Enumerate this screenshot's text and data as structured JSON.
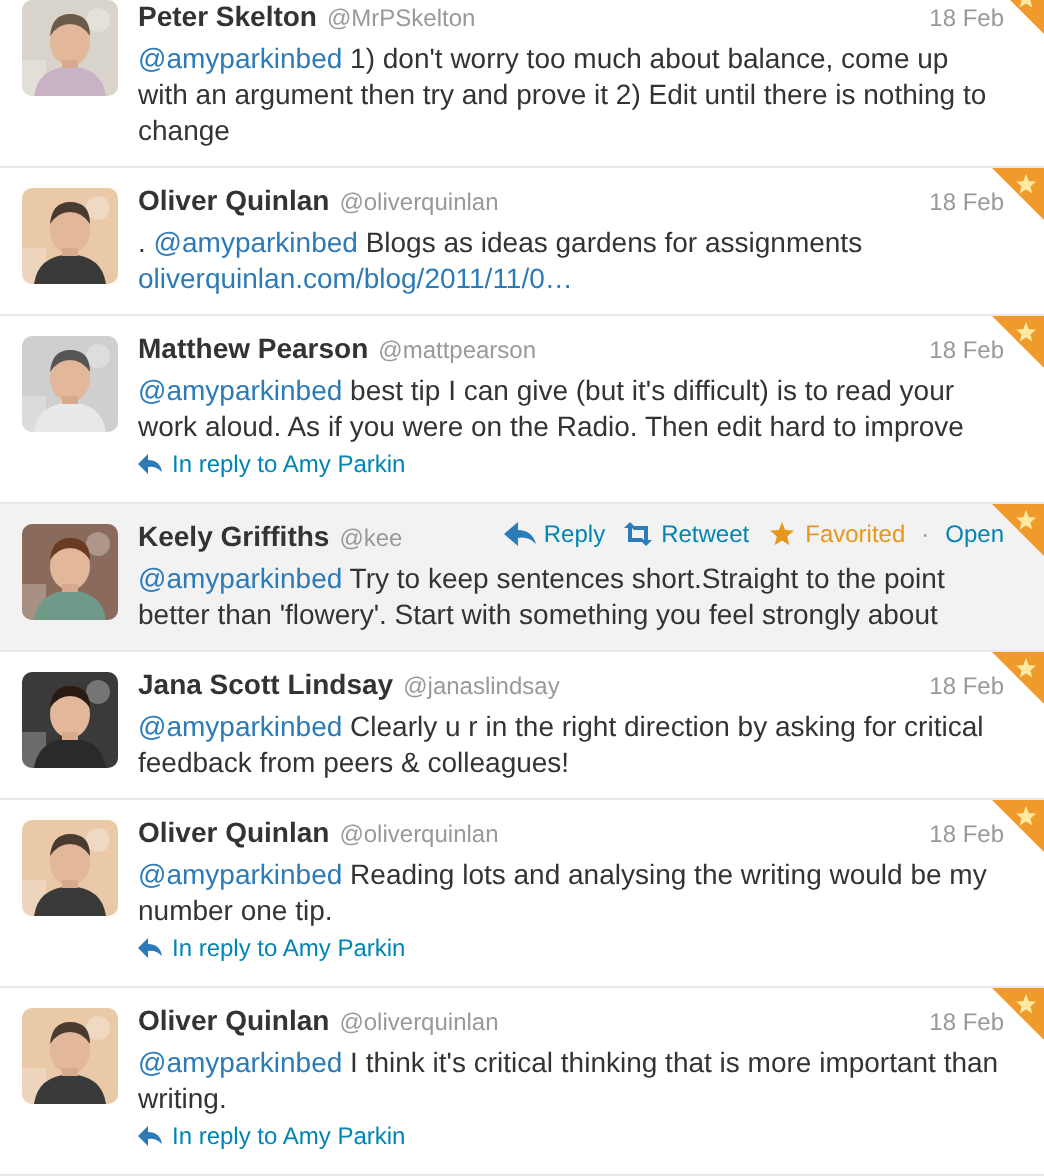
{
  "tweets": [
    {
      "name": "Peter Skelton",
      "handle": "@MrPSkelton",
      "date": "18 Feb",
      "favorited": true,
      "hovered": false,
      "avatar": {
        "kind": "picture"
      },
      "text": [
        {
          "kind": "mention",
          "text": "@amyparkinbed"
        },
        {
          "kind": "text",
          "text": " 1) don't worry too much about balance, come up with an argument then try and prove it 2) Edit until there is nothing to change"
        }
      ]
    },
    {
      "name": "Oliver Quinlan",
      "handle": "@oliverquinlan",
      "date": "18 Feb",
      "favorited": true,
      "hovered": false,
      "avatar": {
        "kind": "picture"
      },
      "lead": ". ",
      "text": [
        {
          "kind": "mention",
          "text": "@amyparkinbed"
        },
        {
          "kind": "text",
          "text": " Blogs as ideas gardens for assignments "
        },
        {
          "kind": "link",
          "text": "oliverquinlan.com/blog/2011/11/0…"
        }
      ]
    },
    {
      "name": "Matthew Pearson",
      "handle": "@mattpearson",
      "date": "18 Feb",
      "favorited": true,
      "hovered": false,
      "avatar": {
        "kind": "picture"
      },
      "text": [
        {
          "kind": "mention",
          "text": "@amyparkinbed"
        },
        {
          "kind": "text",
          "text": " best tip I can give (but it's difficult) is to read your work aloud. As if you were on the Radio. Then edit hard to improve"
        }
      ],
      "reply_to": "In reply to Amy Parkin"
    },
    {
      "name": "Keely Griffiths",
      "handle": "@kee",
      "favorited": true,
      "hovered": true,
      "avatar": {
        "kind": "picture"
      },
      "actions": [
        {
          "kind": "reply",
          "label": "Reply"
        },
        {
          "kind": "retweet",
          "label": "Retweet"
        },
        {
          "kind": "favorite",
          "label": "Favorited"
        },
        {
          "kind": "separator",
          "label": "·"
        },
        {
          "kind": "open",
          "label": "Open"
        }
      ],
      "text": [
        {
          "kind": "mention",
          "text": "@amyparkinbed"
        },
        {
          "kind": "text",
          "text": " Try to keep sentences short.Straight to the point better than 'flowery'. Start with something you feel strongly about"
        }
      ]
    },
    {
      "name": "Jana Scott Lindsay",
      "handle": "@janaslindsay",
      "date": "18 Feb",
      "favorited": true,
      "hovered": false,
      "avatar": {
        "kind": "picture"
      },
      "text": [
        {
          "kind": "mention",
          "text": "@amyparkinbed"
        },
        {
          "kind": "text",
          "text": " Clearly u r in the right direction by asking for critical feedback from peers & colleagues!"
        }
      ]
    },
    {
      "name": "Oliver Quinlan",
      "handle": "@oliverquinlan",
      "date": "18 Feb",
      "favorited": true,
      "hovered": false,
      "avatar": {
        "kind": "picture"
      },
      "text": [
        {
          "kind": "mention",
          "text": "@amyparkinbed"
        },
        {
          "kind": "text",
          "text": " Reading lots and analysing the writing would be my number one tip."
        }
      ],
      "reply_to": "In reply to Amy Parkin"
    },
    {
      "name": "Oliver Quinlan",
      "handle": "@oliverquinlan",
      "date": "18 Feb",
      "favorited": true,
      "hovered": false,
      "avatar": {
        "kind": "picture"
      },
      "text": [
        {
          "kind": "mention",
          "text": "@amyparkinbed"
        },
        {
          "kind": "text",
          "text": " I think it's critical thinking that is more important than writing."
        }
      ],
      "reply_to": "In reply to Amy Parkin"
    }
  ]
}
